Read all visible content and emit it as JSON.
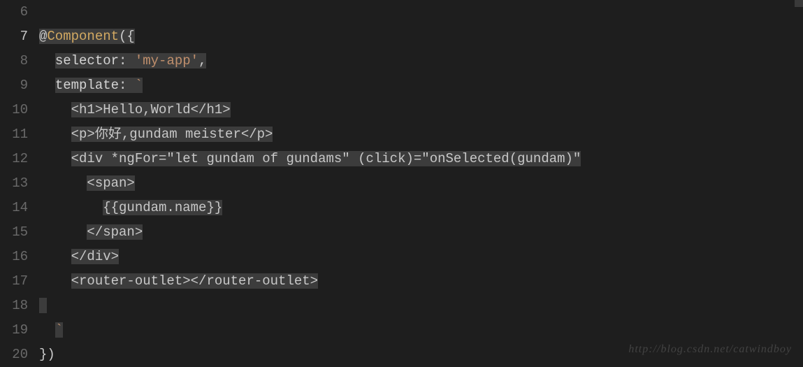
{
  "gutter": {
    "start": 6,
    "end": 20,
    "active": 7
  },
  "code": {
    "lines": [
      {
        "n": 6,
        "raw": ""
      },
      {
        "n": 7,
        "segments": [
          {
            "t": "@",
            "cls": "tok-punct",
            "hl": true
          },
          {
            "t": "Component",
            "cls": "tok-decorator",
            "hl": true
          },
          {
            "t": "({",
            "cls": "tok-punct",
            "hl": true
          }
        ]
      },
      {
        "n": 8,
        "indent": "  ",
        "segments": [
          {
            "t": "selector",
            "cls": "tok-prop",
            "hl": true
          },
          {
            "t": ": ",
            "cls": "tok-punct",
            "hl": true
          },
          {
            "t": "'my-app'",
            "cls": "tok-string",
            "hl": true
          },
          {
            "t": ",",
            "cls": "tok-punct",
            "hl": true
          }
        ]
      },
      {
        "n": 9,
        "indent": "  ",
        "segments": [
          {
            "t": "template",
            "cls": "tok-prop",
            "hl": true
          },
          {
            "t": ": ",
            "cls": "tok-punct",
            "hl": true
          },
          {
            "t": "`",
            "cls": "tok-string",
            "hl": true
          }
        ]
      },
      {
        "n": 10,
        "indent": "    ",
        "segments": [
          {
            "t": "<h1>Hello,World</h1>",
            "cls": "tok-template",
            "hl": true
          }
        ]
      },
      {
        "n": 11,
        "indent": "    ",
        "segments": [
          {
            "t": "<p>你好,gundam meister</p>",
            "cls": "tok-template",
            "hl": true
          }
        ]
      },
      {
        "n": 12,
        "indent": "    ",
        "segments": [
          {
            "t": "<div *ngFor=\"let gundam of gundams\" (click)=\"onSelected(gundam)\"",
            "cls": "tok-template",
            "hl": true
          }
        ]
      },
      {
        "n": 13,
        "indent": "      ",
        "segments": [
          {
            "t": "<span>",
            "cls": "tok-template",
            "hl": true
          }
        ]
      },
      {
        "n": 14,
        "indent": "        ",
        "segments": [
          {
            "t": "{{gundam.name}}",
            "cls": "tok-template",
            "hl": true
          }
        ]
      },
      {
        "n": 15,
        "indent": "      ",
        "segments": [
          {
            "t": "</span>",
            "cls": "tok-template",
            "hl": true
          }
        ]
      },
      {
        "n": 16,
        "indent": "    ",
        "segments": [
          {
            "t": "</div>",
            "cls": "tok-template",
            "hl": true
          }
        ]
      },
      {
        "n": 17,
        "indent": "    ",
        "segments": [
          {
            "t": "<router-outlet></router-outlet>",
            "cls": "tok-template",
            "hl": true
          }
        ]
      },
      {
        "n": 18,
        "indent": "",
        "segments": [
          {
            "t": " ",
            "cls": "tok-template",
            "hl": true
          }
        ]
      },
      {
        "n": 19,
        "indent": "  ",
        "segments": [
          {
            "t": "`",
            "cls": "tok-string",
            "hl": true
          }
        ]
      },
      {
        "n": 20,
        "segments": [
          {
            "t": "})",
            "cls": "tok-punct",
            "hl": false
          }
        ]
      }
    ]
  },
  "watermark": "http://blog.csdn.net/catwindboy"
}
